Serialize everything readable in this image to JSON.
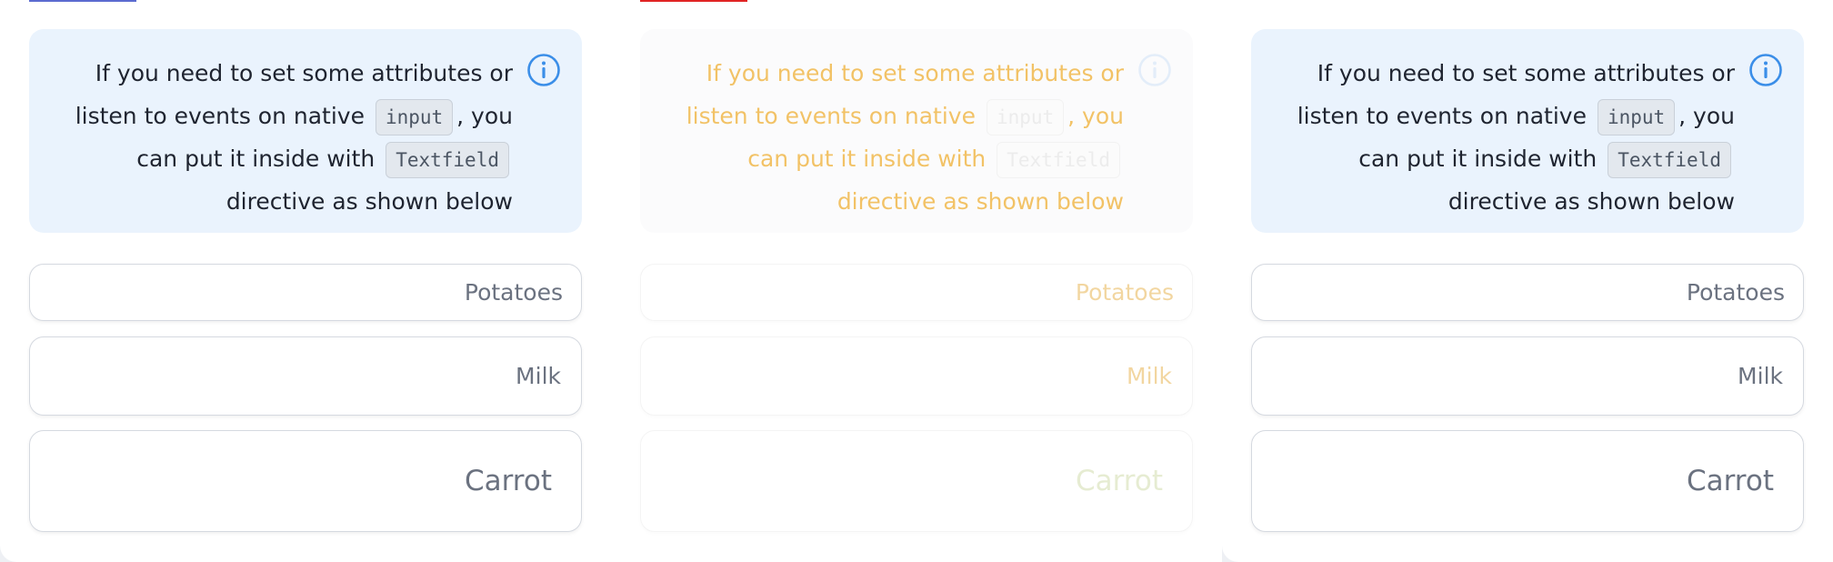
{
  "colors": {
    "card_bg": "#eaf3fd",
    "info_icon": "#3b8ee8",
    "tab_blue": "#5b6bd0",
    "tab_red": "#e02424",
    "ghost_text": "#f0b541"
  },
  "info": {
    "icon": "info-icon",
    "text_before_input": "If you need to set some attributes or listen to events on native",
    "code_input": "input",
    "text_middle": ", you can put it inside with",
    "code_textfield": "Textfield",
    "text_after": "directive as shown below"
  },
  "fields": [
    {
      "value": "Potatoes"
    },
    {
      "value": "Milk"
    },
    {
      "value": "Carrot"
    }
  ]
}
